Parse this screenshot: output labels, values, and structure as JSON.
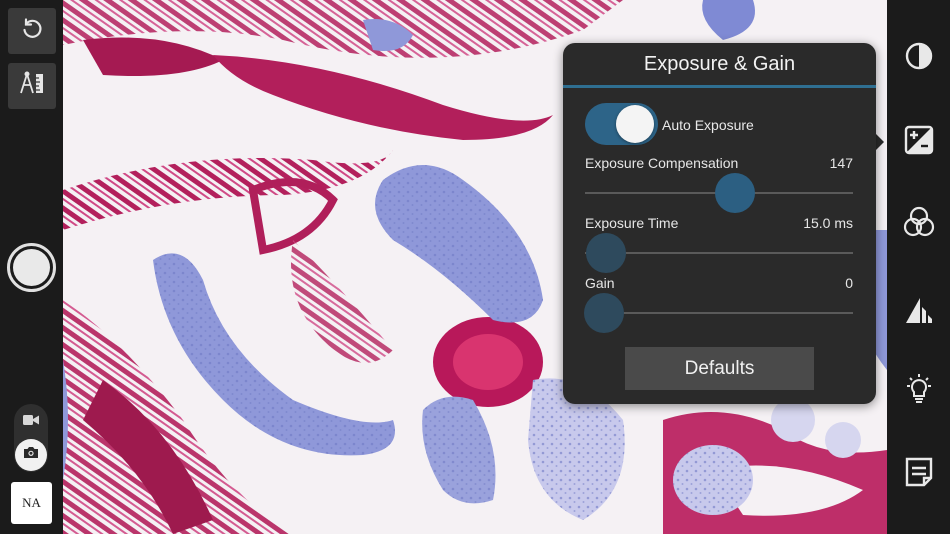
{
  "left_toolbar": {
    "rotate_icon": "rotate-ccw-icon",
    "measure_icon": "measure-ruler-icon",
    "na_label": "NA"
  },
  "right_toolbar": {
    "icons": [
      "contrast-icon",
      "exposure-icon",
      "color-balance-icon",
      "histogram-icon",
      "lighting-bulb-icon",
      "notes-icon"
    ],
    "active": "exposure-icon"
  },
  "panel": {
    "title": "Exposure & Gain",
    "auto_exposure": {
      "label": "Auto Exposure",
      "on": true
    },
    "sliders": [
      {
        "label": "Exposure Compensation",
        "value": "147",
        "fraction": 0.56
      },
      {
        "label": "Exposure Time",
        "value": "15.0 ms",
        "fraction": 0.08
      },
      {
        "label": "Gain",
        "value": "0",
        "fraction": 0.07
      }
    ],
    "defaults_label": "Defaults"
  },
  "colors": {
    "accent": "#2f6f91",
    "thumb": "#2c5f82",
    "thumb_inactive": "#2e4a5d",
    "panel_bg": "#2a2a2a",
    "stain_magenta": "#b0205a",
    "stain_blue": "#8a94d6"
  }
}
